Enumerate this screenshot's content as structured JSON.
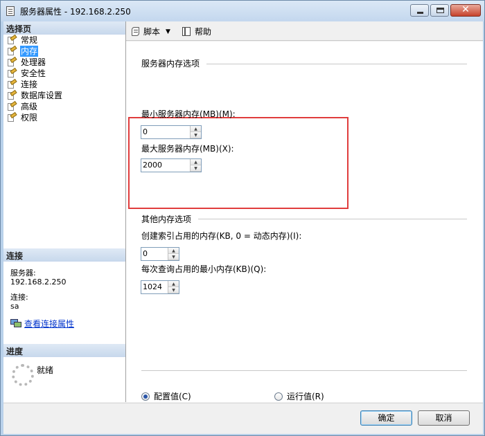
{
  "window": {
    "title": "服务器属性 - 192.168.2.250"
  },
  "select_page": {
    "header": "选择页",
    "items": [
      {
        "label": "常规",
        "selected": false
      },
      {
        "label": "内存",
        "selected": true
      },
      {
        "label": "处理器",
        "selected": false
      },
      {
        "label": "安全性",
        "selected": false
      },
      {
        "label": "连接",
        "selected": false
      },
      {
        "label": "数据库设置",
        "selected": false
      },
      {
        "label": "高级",
        "selected": false
      },
      {
        "label": "权限",
        "selected": false
      }
    ]
  },
  "connection": {
    "header": "连接",
    "server_label": "服务器:",
    "server_value": "192.168.2.250",
    "conn_label": "连接:",
    "conn_value": "sa",
    "view_link": "查看连接属性"
  },
  "progress": {
    "header": "进度",
    "status": "就绪"
  },
  "toolbar": {
    "script_label": "脚本",
    "help_label": "帮助"
  },
  "server_memory": {
    "group_title": "服务器内存选项",
    "min_label": "最小服务器内存(MB)(M):",
    "min_value": "0",
    "max_label": "最大服务器内存(MB)(X):",
    "max_value": "2000"
  },
  "other_memory": {
    "group_title": "其他内存选项",
    "index_label": "创建索引占用的内存(KB, 0 = 动态内存)(I):",
    "index_value": "0",
    "query_label": "每次查询占用的最小内存(KB)(Q):",
    "query_value": "1024"
  },
  "values_mode": {
    "configured_label": "配置值(C)",
    "configured_checked": true,
    "running_label": "运行值(R)",
    "running_checked": false
  },
  "buttons": {
    "ok_label": "确定",
    "cancel_label": "取消"
  },
  "colors": {
    "highlight_box": "#e03c3c",
    "selection": "#3399ff"
  }
}
